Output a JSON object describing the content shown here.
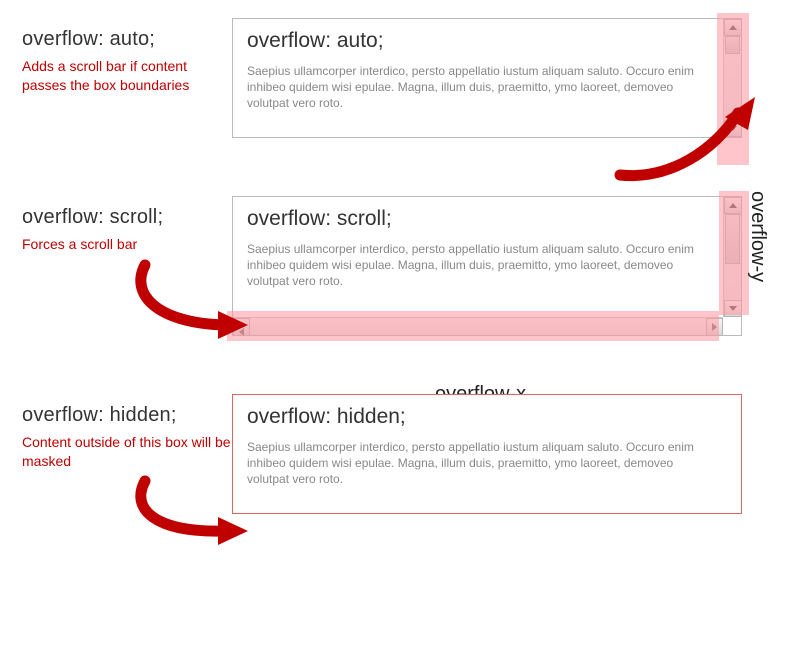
{
  "row1": {
    "label_title": "overflow: auto;",
    "label_desc": "Adds a scroll bar if content passes the box boundaries",
    "panel_title": "overflow: auto;",
    "panel_body": "Saepius ullamcorper interdico, persto appellatio iustum aliquam saluto. Occuro enim inhibeo quidem wisi epulae. Magna, illum duis, praemitto, ymo laoreet, demoveo volutpat vero roto."
  },
  "row2": {
    "label_title": "overflow: scroll;",
    "label_desc": "Forces a scroll bar",
    "panel_title": "overflow: scroll;",
    "panel_body": "Saepius ullamcorper interdico, persto appellatio iustum aliquam saluto. Occuro enim inhibeo quidem wisi epulae. Magna, illum duis, praemitto, ymo laoreet, demoveo volutpat vero roto.",
    "axis_x_label": "overflow-x",
    "axis_y_label": "overflow-y"
  },
  "row3": {
    "label_title": "overflow: hidden;",
    "label_desc": "Content outside of this box will be masked",
    "panel_title": "overflow: hidden;",
    "panel_body": "Saepius ullamcorper interdico, persto appellatio iustum aliquam saluto. Occuro enim inhibeo quidem wisi epulae. Magna, illum duis, praemitto, ymo laoreet, demoveo volutpat vero roto."
  }
}
